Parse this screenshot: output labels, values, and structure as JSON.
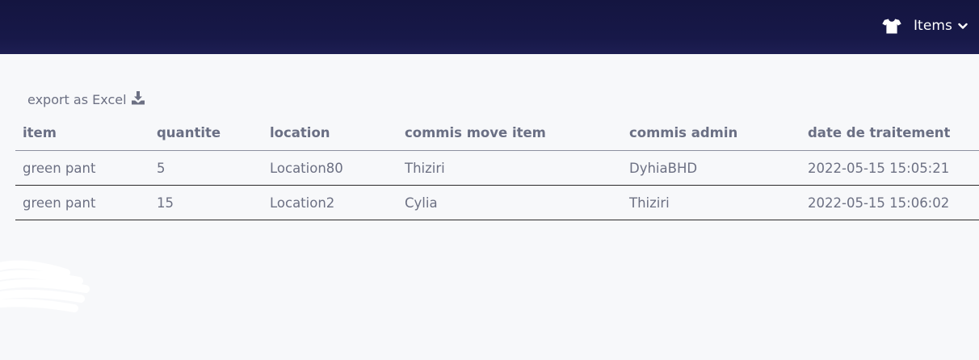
{
  "header": {
    "menu_label": "Items",
    "menu_icon": "tshirt-icon",
    "dropdown_icon": "chevron-down-icon",
    "background": "#161746"
  },
  "toolbar": {
    "export_label": "export as Excel",
    "export_icon": "download-icon"
  },
  "table": {
    "columns": [
      "item",
      "quantite",
      "location",
      "commis move item",
      "commis admin",
      "date de traitement"
    ],
    "rows": [
      [
        "green pant",
        "5",
        "Location80",
        "Thiziri",
        "DyhiaBHD",
        "2022-05-15 15:05:21"
      ],
      [
        "green pant",
        "15",
        "Location2",
        "Cylia",
        "Thiziri",
        "2022-05-15 15:06:02"
      ]
    ]
  }
}
